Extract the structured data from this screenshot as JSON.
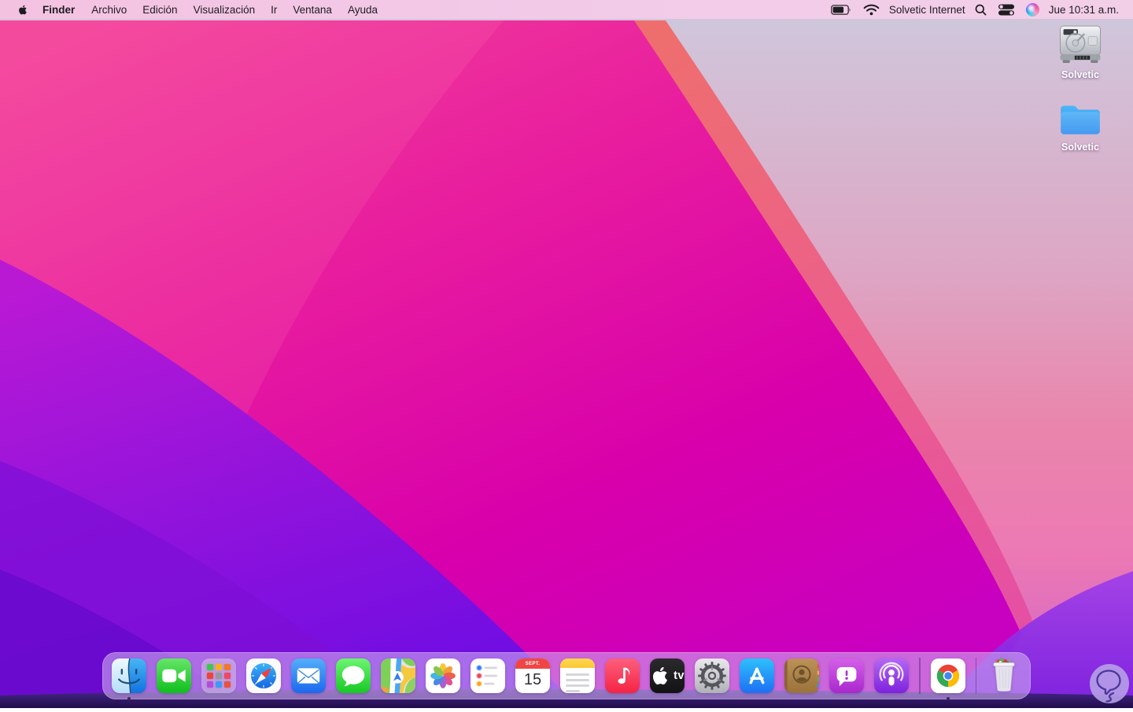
{
  "menu_bar": {
    "apple_icon": "apple-logo-icon",
    "menus": [
      {
        "label": "Finder",
        "bold": true
      },
      {
        "label": "Archivo"
      },
      {
        "label": "Edición"
      },
      {
        "label": "Visualización"
      },
      {
        "label": "Ir"
      },
      {
        "label": "Ventana"
      },
      {
        "label": "Ayuda"
      }
    ],
    "status": {
      "icons": [
        "battery-icon",
        "wifi-icon",
        "spotlight-search-icon",
        "control-center-icon",
        "siri-icon"
      ],
      "network_name": "Solvetic Internet",
      "clock": "Jue 10:31 a.m."
    }
  },
  "desktop": {
    "icons": [
      {
        "label": "Solvetic",
        "icon": "hard-drive-icon"
      },
      {
        "label": "Solvetic",
        "icon": "folder-icon"
      }
    ],
    "watermark": "solvetic-logo"
  },
  "dock": {
    "apps": [
      {
        "name": "Finder",
        "icon": "finder-icon",
        "running": true
      },
      {
        "name": "FaceTime",
        "icon": "facetime-icon"
      },
      {
        "name": "Launchpad",
        "icon": "launchpad-icon"
      },
      {
        "name": "Safari",
        "icon": "safari-icon"
      },
      {
        "name": "Mail",
        "icon": "mail-icon"
      },
      {
        "name": "Messages",
        "icon": "messages-icon"
      },
      {
        "name": "Maps",
        "icon": "maps-icon"
      },
      {
        "name": "Photos",
        "icon": "photos-icon"
      },
      {
        "name": "Reminders",
        "icon": "reminders-icon"
      },
      {
        "name": "Calendar",
        "icon": "calendar-icon",
        "month": "SEPT.",
        "day": "15"
      },
      {
        "name": "Notes",
        "icon": "notes-icon"
      },
      {
        "name": "Music",
        "icon": "music-icon"
      },
      {
        "name": "Apple TV",
        "icon": "apple-tv-icon",
        "label": "tv"
      },
      {
        "name": "System Preferences",
        "icon": "system-preferences-icon"
      },
      {
        "name": "App Store",
        "icon": "app-store-icon"
      },
      {
        "name": "Contacts",
        "icon": "contacts-icon"
      },
      {
        "name": "Feedback Assistant",
        "icon": "feedback-assistant-icon"
      },
      {
        "name": "Podcasts",
        "icon": "podcasts-icon"
      },
      {
        "name": "Google Chrome",
        "icon": "chrome-icon",
        "running": true
      },
      {
        "name": "Trash",
        "icon": "trash-full-icon"
      }
    ]
  },
  "colors": {
    "menu_bar_tint": "#f2cbe9",
    "dock_tint": "rgba(205,170,240,0.6)",
    "wallpaper_pink": "#e51a9e",
    "wallpaper_purple": "#7a10dc",
    "wallpaper_lavender": "#cfc9dd",
    "wallpaper_coral": "#ee6a73",
    "menu_text": "#1d1d21",
    "desktop_label_text": "#ffffff"
  }
}
